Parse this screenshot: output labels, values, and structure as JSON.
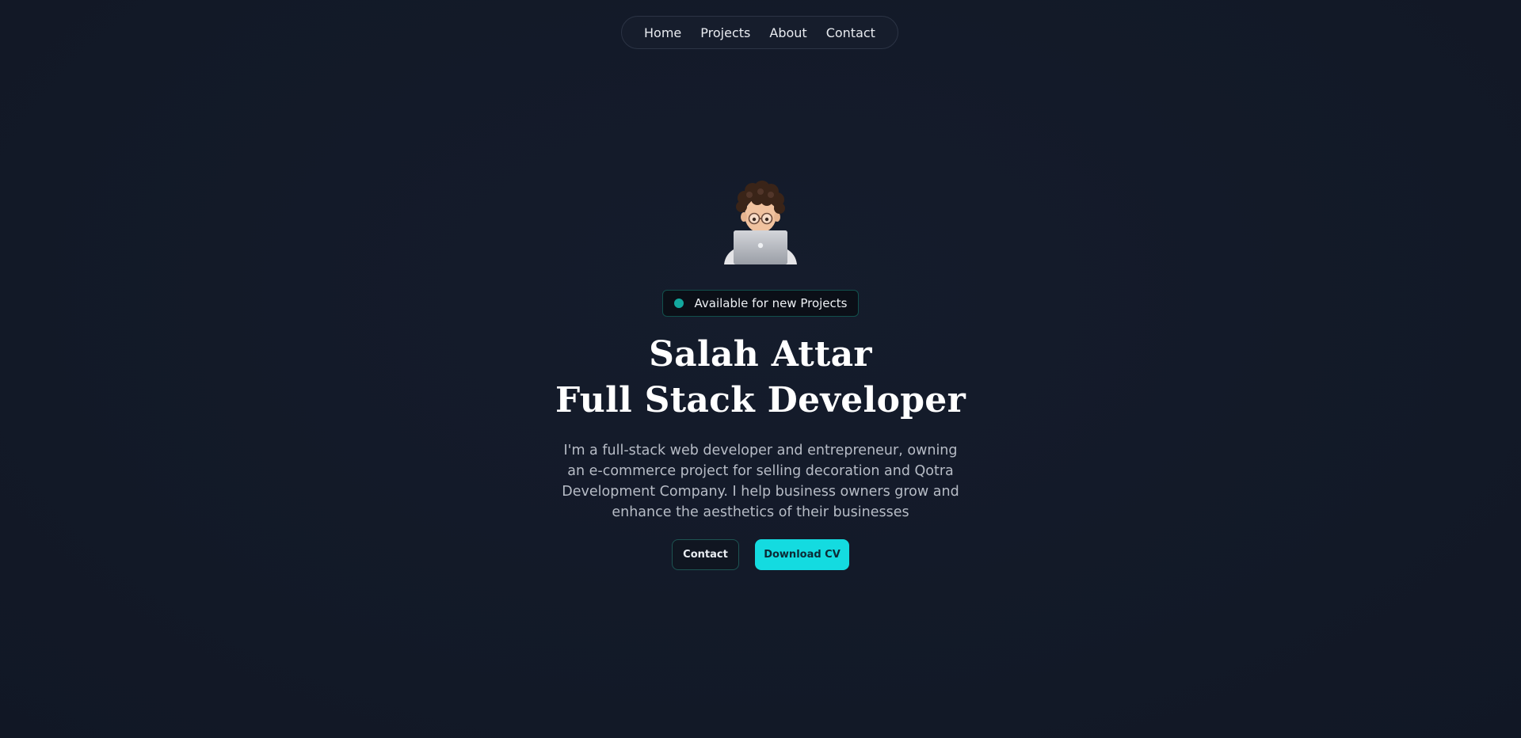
{
  "nav": {
    "items": [
      {
        "label": "Home"
      },
      {
        "label": "Projects"
      },
      {
        "label": "About"
      },
      {
        "label": "Contact"
      }
    ]
  },
  "hero": {
    "avatar_icon": "memoji-developer-with-laptop-icon",
    "badge_text": "Available for new Projects",
    "name_line": "Salah Attar",
    "role_line": "Full Stack Developer",
    "description": "I'm a full-stack web developer and entrepreneur, owning an e-commerce project for selling decoration and Qotra Development Company. I help business owners grow and enhance the aesthetics of their businesses",
    "buttons": {
      "contact_label": "Contact",
      "cv_label": "Download CV"
    }
  },
  "colors": {
    "background": "#131a29",
    "accent": "#14dbe0",
    "status_dot": "#13a89e"
  }
}
